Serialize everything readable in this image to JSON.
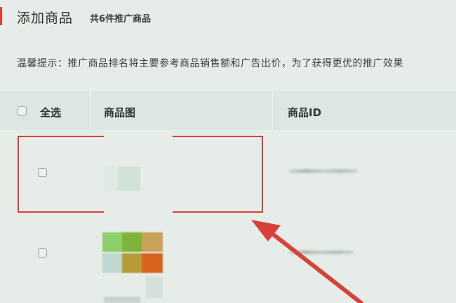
{
  "header": {
    "title": "添加商品",
    "count_text": "共6件推广商品",
    "accent_color": "#d9403a"
  },
  "tip": {
    "text": "温馨提示：推广商品排名将主要参考商品销售额和广告出价，为了获得更优的推广效果"
  },
  "table": {
    "columns": {
      "select_all": "全选",
      "image": "商品图",
      "id": "商品ID"
    },
    "rows": [
      {
        "selected": false,
        "id_value": "",
        "highlighted": true
      },
      {
        "selected": false,
        "id_value": "",
        "highlighted": false
      }
    ]
  },
  "annotation": {
    "arrow_color": "#d9403a",
    "box_color": "#d9403a"
  },
  "icons": [
    "checkbox-icon"
  ]
}
